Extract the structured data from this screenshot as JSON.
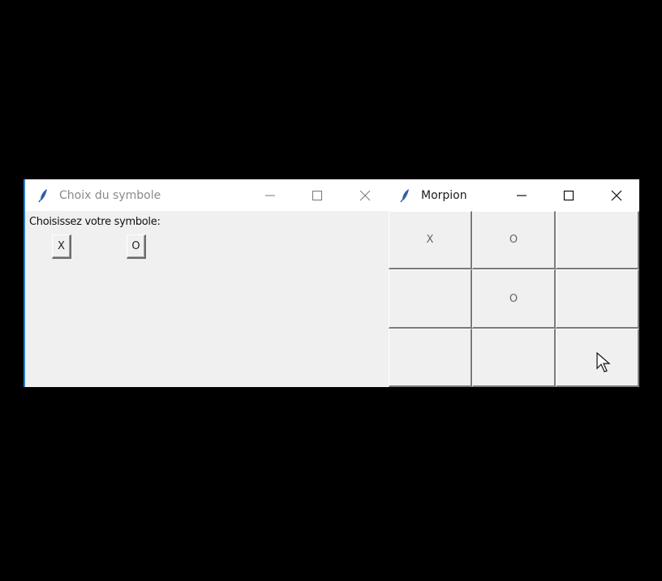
{
  "window_choice": {
    "title": "Choix du symbole",
    "prompt": "Choisissez votre symbole:",
    "options": [
      "X",
      "O"
    ],
    "controls": {
      "minimize": "minimize-icon",
      "maximize": "maximize-icon",
      "close": "close-icon"
    }
  },
  "window_game": {
    "title": "Morpion",
    "board": [
      [
        "X",
        "O",
        ""
      ],
      [
        "",
        "O",
        ""
      ],
      [
        "",
        "",
        ""
      ]
    ],
    "controls": {
      "minimize": "minimize-icon",
      "maximize": "maximize-icon",
      "close": "close-icon"
    }
  },
  "colors": {
    "background": "#000000",
    "window_body": "#f0f0f0",
    "titlebar": "#ffffff",
    "active_border": "#2a7dc7"
  }
}
